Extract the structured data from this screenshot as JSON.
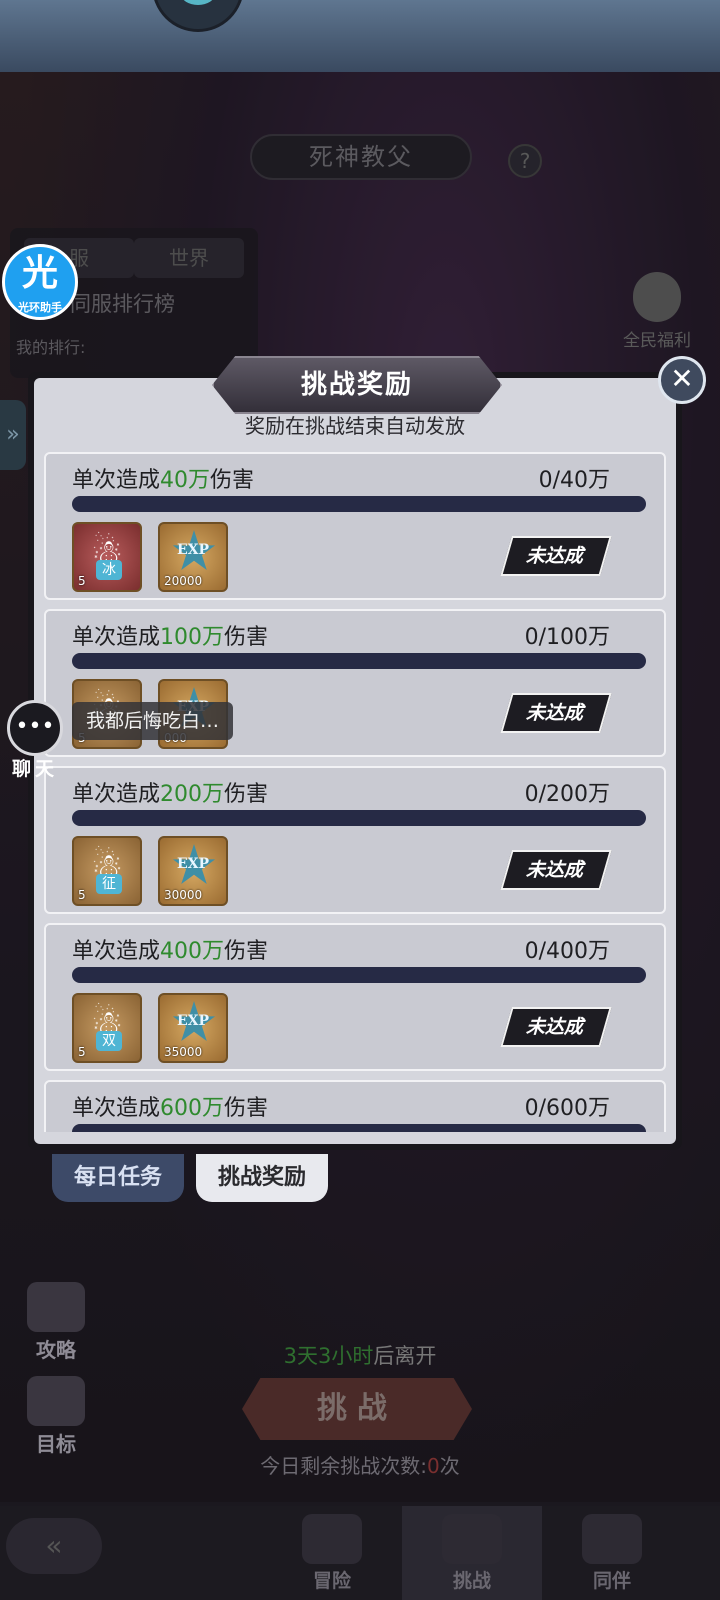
{
  "background": {
    "boss_name": "死神教父",
    "help": "?",
    "rank_tabs": [
      "服",
      "世界"
    ],
    "rank_title": "同服排行榜",
    "rank_mine": "我的排行:",
    "welfare_label": "全民福利",
    "assist_icon": "光",
    "assist_label": "光环助手",
    "side_handle": "»"
  },
  "modal": {
    "title": "挑战奖励",
    "close": "✕",
    "subtitle": "奖励在挑战结束自动发放",
    "status_label": "未达成",
    "rewards": [
      {
        "prefix": "单次造成",
        "amount": "40万",
        "suffix": "伤害",
        "progress": "0/40万",
        "progress_fraction": 0,
        "item_tag": "冰",
        "item_count": "5",
        "item_color": "red",
        "exp_count": "20000"
      },
      {
        "prefix": "单次造成",
        "amount": "100万",
        "suffix": "伤害",
        "progress": "0/100万",
        "progress_fraction": 0,
        "item_tag": "",
        "item_count": "5",
        "item_color": "brown",
        "exp_count": "000"
      },
      {
        "prefix": "单次造成",
        "amount": "200万",
        "suffix": "伤害",
        "progress": "0/200万",
        "progress_fraction": 0,
        "item_tag": "征",
        "item_count": "5",
        "item_color": "brown",
        "exp_count": "30000"
      },
      {
        "prefix": "单次造成",
        "amount": "400万",
        "suffix": "伤害",
        "progress": "0/400万",
        "progress_fraction": 0,
        "item_tag": "双",
        "item_count": "5",
        "item_color": "brown",
        "exp_count": "35000"
      },
      {
        "prefix": "单次造成",
        "amount": "600万",
        "suffix": "伤害",
        "progress": "0/600万",
        "progress_fraction": 0
      }
    ],
    "exp_label": "EXP"
  },
  "tabs": {
    "daily": "每日任务",
    "challenge": "挑战奖励"
  },
  "chat": {
    "icon": "•••",
    "label": "聊天",
    "message": "我都后悔吃白…"
  },
  "lower": {
    "strategy": "攻略",
    "goal": "目标",
    "leave_time": "3天3小时",
    "leave_suffix": "后离开",
    "challenge_button": "挑战",
    "remain_prefix": "今日剩余挑战次数:",
    "remain_count": "0",
    "remain_suffix": "次"
  },
  "nav": {
    "back": "«",
    "items": [
      "冒险",
      "挑战",
      "同伴"
    ],
    "active": "挑战"
  },
  "colors": {
    "highlight_green": "#2f8a2e",
    "bar_track": "#262a45",
    "modal_bg": "#d5d6dd"
  }
}
